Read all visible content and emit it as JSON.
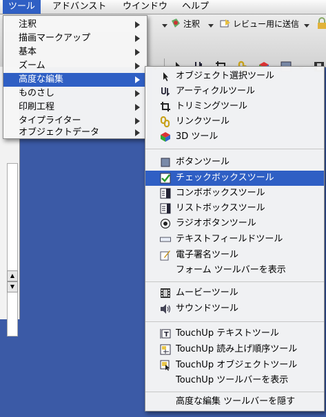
{
  "menubar": {
    "items": [
      {
        "label": "ツール"
      },
      {
        "label": "アドバンスト"
      },
      {
        "label": "ウインドウ"
      },
      {
        "label": "ヘルプ"
      }
    ]
  },
  "toolbar": {
    "comment_label": "注釈",
    "review_label": "レビュー用に送信"
  },
  "tools_menu": {
    "items": [
      {
        "label": "注釈"
      },
      {
        "label": "描画マークアップ"
      },
      {
        "label": "基本"
      },
      {
        "label": "ズーム"
      },
      {
        "label": "高度な編集"
      },
      {
        "label": "ものさし"
      },
      {
        "label": "印刷工程"
      },
      {
        "label": "タイプライター"
      },
      {
        "label": "オブジェクトデータ"
      }
    ]
  },
  "advanced_editing_menu": {
    "group1": [
      {
        "label": "オブジェクト選択ツール",
        "icon": "pointer-arrow-icon"
      },
      {
        "label": "アーティクルツール",
        "icon": "article-icon"
      },
      {
        "label": "トリミングツール",
        "icon": "crop-icon"
      },
      {
        "label": "リンクツール",
        "icon": "link-chain-icon"
      },
      {
        "label": "3D ツール",
        "icon": "3d-cube-icon"
      }
    ],
    "group2": [
      {
        "label": "ボタンツール",
        "icon": "button-square-icon"
      },
      {
        "label": "チェックボックスツール",
        "icon": "checkbox-icon"
      },
      {
        "label": "コンボボックスツール",
        "icon": "combo-box-icon"
      },
      {
        "label": "リストボックスツール",
        "icon": "list-box-icon"
      },
      {
        "label": "ラジオボタンツール",
        "icon": "radio-button-icon"
      },
      {
        "label": "テキストフィールドツール",
        "icon": "text-field-icon"
      },
      {
        "label": "電子署名ツール",
        "icon": "signature-pen-icon"
      },
      {
        "label": "フォーム ツールバーを表示",
        "icon": ""
      }
    ],
    "group3": [
      {
        "label": "ムービーツール",
        "icon": "film-strip-icon"
      },
      {
        "label": "サウンドツール",
        "icon": "speaker-icon"
      }
    ],
    "group4": [
      {
        "label": "TouchUp テキストツール",
        "icon": "touchup-text-icon"
      },
      {
        "label": "TouchUp 読み上げ順序ツール",
        "icon": "reading-order-icon"
      },
      {
        "label": "TouchUp オブジェクトツール",
        "icon": "touchup-object-icon"
      },
      {
        "label": "TouchUp  ツールバーを表示",
        "icon": ""
      }
    ],
    "group5": [
      {
        "label": "高度な編集 ツールバーを隠す",
        "icon": ""
      }
    ]
  },
  "colors": {
    "highlight": "#2f5fc4",
    "desktop": "#3b5aa6"
  }
}
